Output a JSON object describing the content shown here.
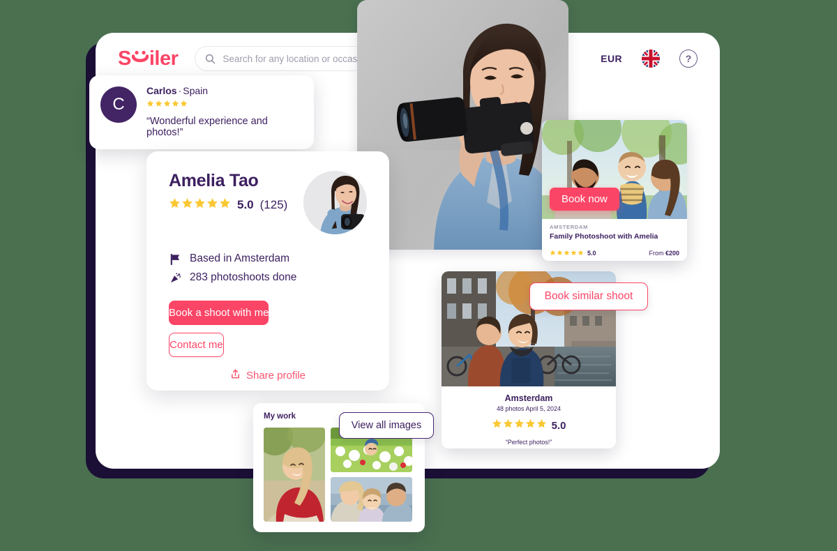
{
  "theme": {
    "background": "#4a7050",
    "accent_pink": "#fb4566",
    "accent_purple": "#3d2060",
    "star_yellow": "#fac832",
    "shadow_navy": "#1b0f36"
  },
  "header": {
    "logo_text_before": "S",
    "logo_glyph": "smile-m-glyph",
    "logo_text_after": "iler",
    "logo_full": "Smiler",
    "search": {
      "placeholder": "Search for any location or occasion",
      "value": "",
      "icon": "search-icon"
    },
    "currency": "EUR",
    "language_flag": "uk-flag-icon",
    "help": "?"
  },
  "hero": {
    "alt": "photographer-holding-camera",
    "icon": "hero-photo"
  },
  "review_pill": {
    "avatar_initial": "C",
    "reviewer_name": "Carlos",
    "separator": "·",
    "reviewer_country": "Spain",
    "stars": 5,
    "quote": "“Wonderful experience and photos!”"
  },
  "profile": {
    "name": "Amelia Tao",
    "stars": 5,
    "rating": "5.0",
    "review_count": "(125)",
    "avatar_alt": "amelia-tao-avatar",
    "facts": [
      {
        "icon": "flag-icon",
        "label": "Based in Amsterdam"
      },
      {
        "icon": "party-popper-icon",
        "label": "283 photoshoots done"
      }
    ],
    "primary_button": "Book a shoot with me",
    "secondary_button": "Contact me",
    "share_label": "Share profile",
    "share_icon": "share-icon"
  },
  "booking_card": {
    "cta": "Book now",
    "eyebrow": "AMSTERDAM",
    "title": "Family Photoshoot with Amelia",
    "stars": 5,
    "rating": "5.0",
    "price_prefix": "From",
    "price": "€200",
    "photo_alt": "family-lifting-baby-outdoors"
  },
  "shoot_card": {
    "city": "Amsterdam",
    "meta": "48 photos April 5, 2024",
    "stars": 5,
    "rating": "5.0",
    "quote": "“Perfect photos!”",
    "photo_alt": "couple-by-amsterdam-canal"
  },
  "tooltips": {
    "book_similar": "Book similar shoot",
    "view_all_images": "View all images"
  },
  "my_work": {
    "title": "My work",
    "photos": [
      {
        "alt": "woman-in-red-cardigan"
      },
      {
        "alt": "child-in-tulip-field"
      },
      {
        "alt": "family-kissing-child"
      }
    ]
  }
}
